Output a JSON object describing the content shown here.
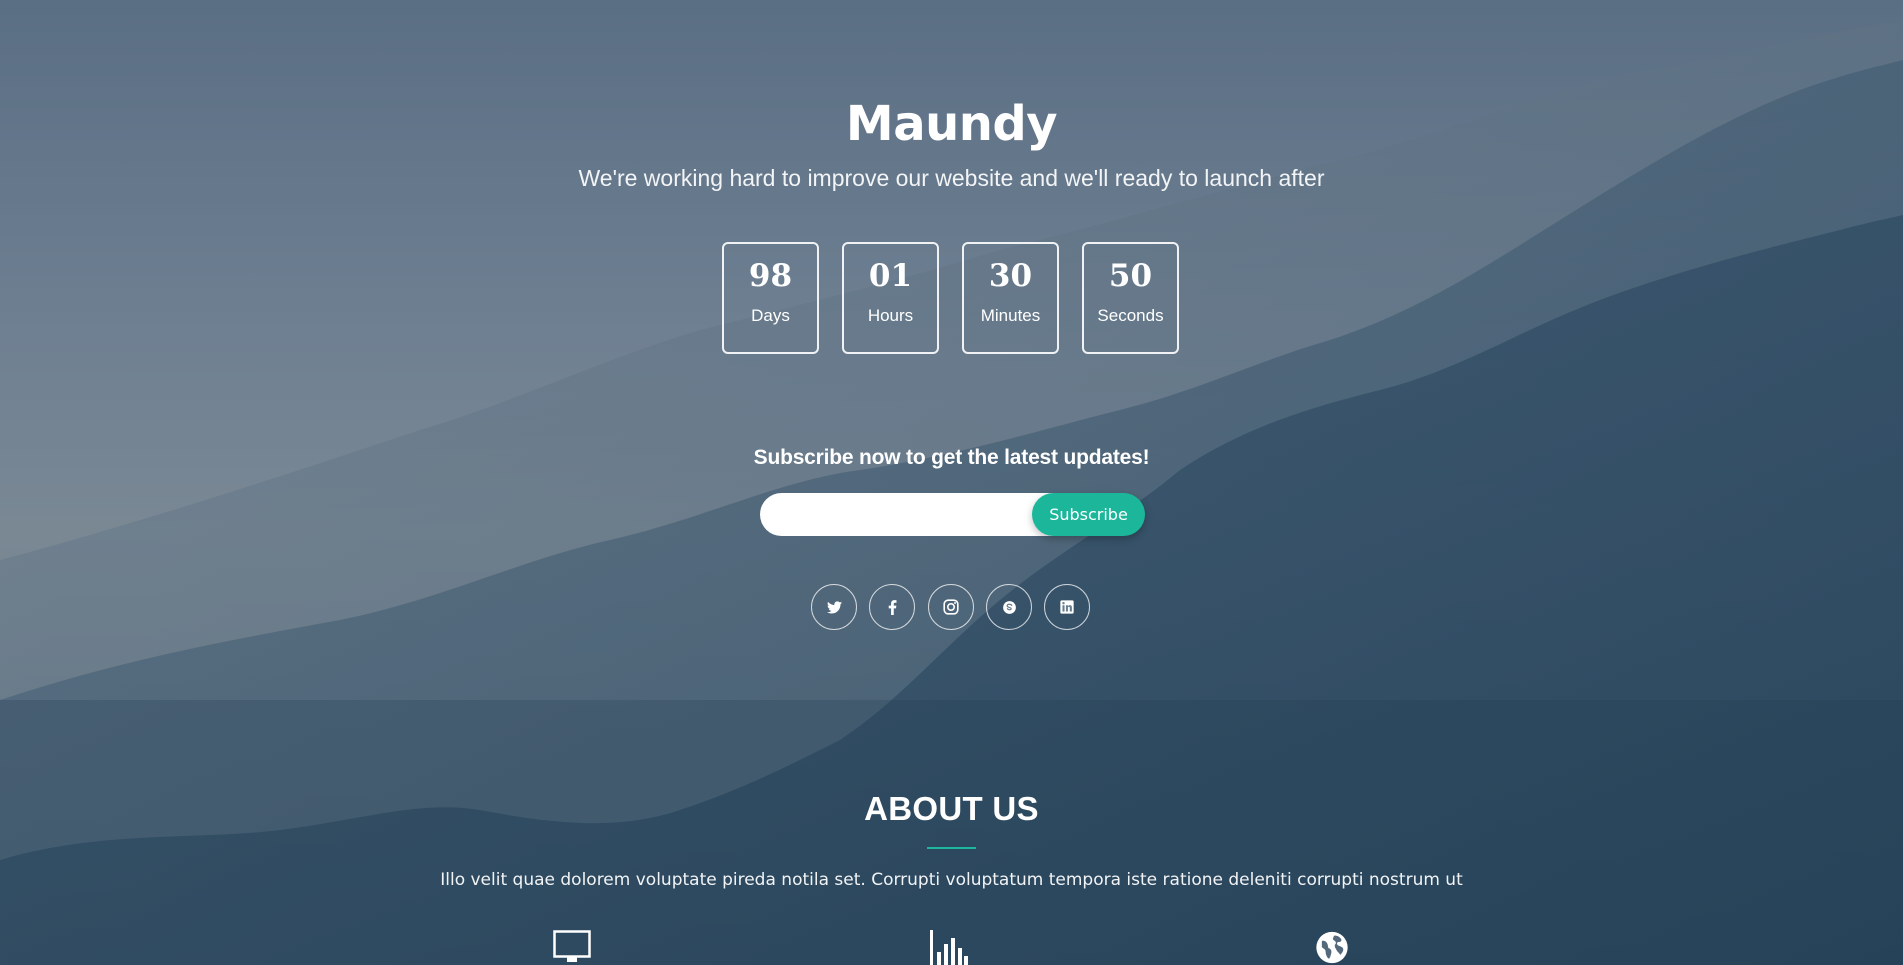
{
  "page": {
    "brand": "Maundy",
    "tagline": "We're working hard to improve our website and we'll ready to launch after"
  },
  "countdown": [
    {
      "value": "98",
      "label": "Days"
    },
    {
      "value": "01",
      "label": "Hours"
    },
    {
      "value": "30",
      "label": "Minutes"
    },
    {
      "value": "50",
      "label": "Seconds"
    }
  ],
  "subscribe": {
    "heading": "Subscribe now to get the latest updates!",
    "email_placeholder": "",
    "button_label": "Subscribe"
  },
  "socials": [
    {
      "icon": "twitter-icon"
    },
    {
      "icon": "facebook-icon"
    },
    {
      "icon": "instagram-icon"
    },
    {
      "icon": "skype-icon"
    },
    {
      "icon": "linkedin-icon"
    }
  ],
  "about": {
    "heading": "ABOUT US",
    "text": "Illo velit quae dolorem voluptate pireda notila set. Corrupti voluptatum tempora iste ratione deleniti corrupti nostrum ut",
    "features": [
      {
        "icon": "monitor-icon"
      },
      {
        "icon": "bar-chart-icon"
      },
      {
        "icon": "globe-icon"
      }
    ]
  },
  "colors": {
    "accent": "#1cb79b",
    "sky_top": "#5c7186",
    "sky_mid": "#7a8894",
    "mountain_dark": "#25435a"
  }
}
